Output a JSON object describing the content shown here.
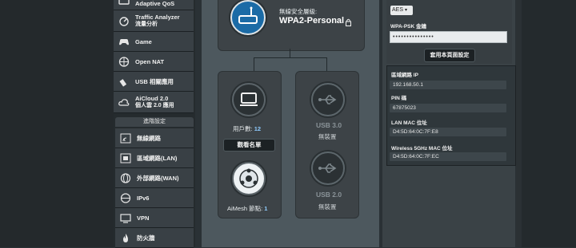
{
  "sidebar": {
    "items": [
      {
        "label": "Adaptive QoS",
        "icon": "qos-icon"
      },
      {
        "label": "Traffic Analyzer",
        "sub": "流量分析",
        "icon": "traffic-analyzer-icon"
      },
      {
        "label": "Game",
        "icon": "gamepad-icon"
      },
      {
        "label": "Open NAT",
        "icon": "open-nat-icon"
      },
      {
        "label": "USB 相關應用",
        "icon": "usb-icon"
      },
      {
        "label": "AiCloud 2.0",
        "sub": "個人雲 2.0 應用",
        "icon": "cloud-icon"
      }
    ],
    "advanced_header": "進階設定",
    "advanced_items": [
      {
        "label": "無線網路",
        "icon": "wireless-icon"
      },
      {
        "label": "區域網路(LAN)",
        "icon": "lan-icon"
      },
      {
        "label": "外部網路(WAN)",
        "icon": "wan-icon"
      },
      {
        "label": "IPv6",
        "icon": "ipv6-icon"
      },
      {
        "label": "VPN",
        "icon": "vpn-icon"
      },
      {
        "label": "防火牆",
        "icon": "firewall-icon"
      }
    ]
  },
  "network_map": {
    "security_label": "無線安全層級:",
    "security_value": "WPA2-Personal",
    "clients_label": "用戶數:",
    "clients_count": "12",
    "client_list_button": "觀看名單",
    "aimesh_label": "AiMesh 節點:",
    "aimesh_count": "1",
    "usb3_label": "USB 3.0",
    "usb3_status": "無裝置",
    "usb2_label": "USB 2.0",
    "usb2_status": "無裝置"
  },
  "right_panel": {
    "encryption_value": "AES",
    "wpa_key_label": "WPA-PSK 金鑰",
    "wpa_key_value": "•••••••••••••••",
    "apply_button": "套用本頁面設定",
    "lan_ip_label": "區域網路 IP",
    "lan_ip_value": "192.168.50.1",
    "pin_label": "PIN 碼",
    "pin_value": "67875023",
    "lan_mac_label": "LAN MAC 位址",
    "lan_mac_value": "D4:5D:64:0C:7F:E8",
    "wifi5_mac_label": "Wireless 5GHz MAC 位址",
    "wifi5_mac_value": "D4:5D:64:0C:7F:EC"
  }
}
